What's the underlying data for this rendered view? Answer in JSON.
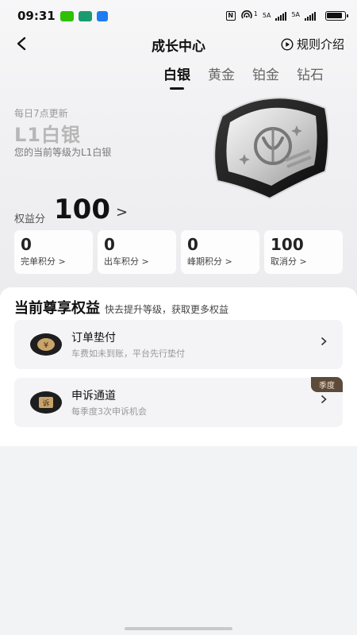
{
  "status_bar": {
    "time": "09:31",
    "network_1": "5A",
    "network_2": "5A",
    "signal_sup": "1",
    "icons": [
      "wechat-icon",
      "app-icon",
      "upload-icon",
      "nfc-icon",
      "hotspot-icon",
      "signal-icon",
      "battery-icon"
    ]
  },
  "header": {
    "title": "成长中心",
    "rules_label": "规则介绍"
  },
  "tabs": [
    {
      "label": "白银",
      "active": true
    },
    {
      "label": "黄金",
      "active": false
    },
    {
      "label": "铂金",
      "active": false
    },
    {
      "label": "钻石",
      "active": false
    }
  ],
  "level": {
    "update_note": "每日7点更新",
    "name": "L1白银",
    "description": "您的当前等级为L1白银",
    "badge_icon": "silver-badge-icon"
  },
  "score": {
    "label": "权益分",
    "value": "100",
    "arrow": ">"
  },
  "stats": [
    {
      "value": "0",
      "label": "完单积分 >"
    },
    {
      "value": "0",
      "label": "出车积分 >"
    },
    {
      "value": "0",
      "label": "峰期积分 >"
    },
    {
      "value": "100",
      "label": "取消分 >"
    }
  ],
  "benefits": {
    "title": "当前尊享权益",
    "subtitle": "快去提升等级，获取更多权益",
    "items": [
      {
        "title": "订单垫付",
        "description": "车费如未到账，平台先行垫付",
        "icon": "yuan-coin-icon",
        "icon_char": "¥"
      },
      {
        "title": "申诉通道",
        "description": "每季度3次申诉机会",
        "icon": "appeal-icon",
        "icon_char": "诉",
        "tag": "季度"
      }
    ]
  },
  "colors": {
    "accent": "#111111",
    "tag_bg": "#5d4a3a",
    "level_text": "#b7b7b7"
  }
}
